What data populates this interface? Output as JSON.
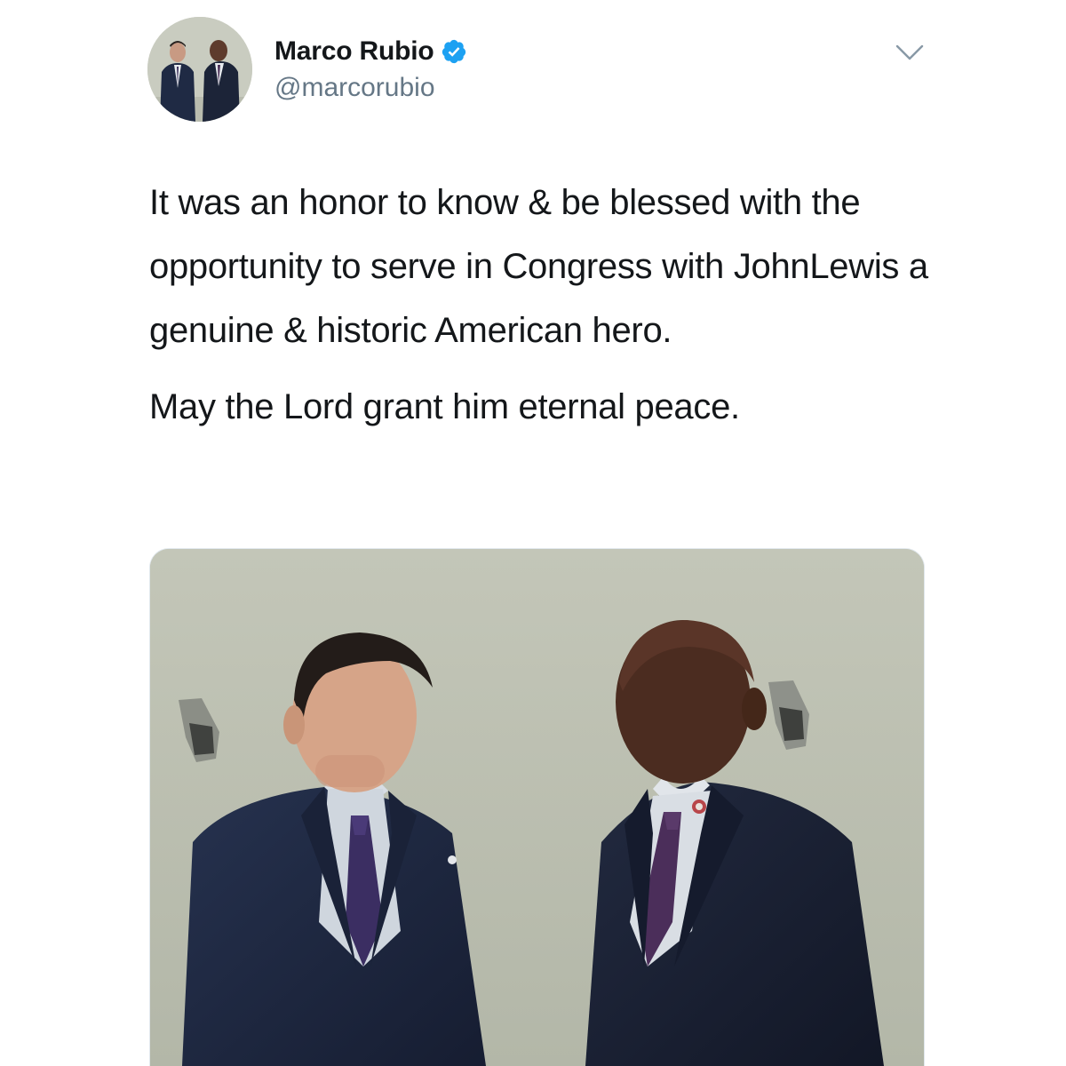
{
  "tweet": {
    "author": {
      "display_name": "Marco Rubio",
      "handle": "@marcorubio",
      "verified": true,
      "avatar_icon": "profile-photo"
    },
    "menu_icon": "chevron-down-icon",
    "text": {
      "paragraph_1": "It was an honor to know & be blessed with the opportunity to serve in Congress with JohnLewis a genuine & historic American hero.",
      "paragraph_2": "May the Lord grant him eternal peace."
    },
    "media": {
      "type": "photo"
    },
    "colors": {
      "verified_badge": "#1da1f2",
      "secondary_text": "#657786",
      "primary_text": "#14171a"
    }
  }
}
